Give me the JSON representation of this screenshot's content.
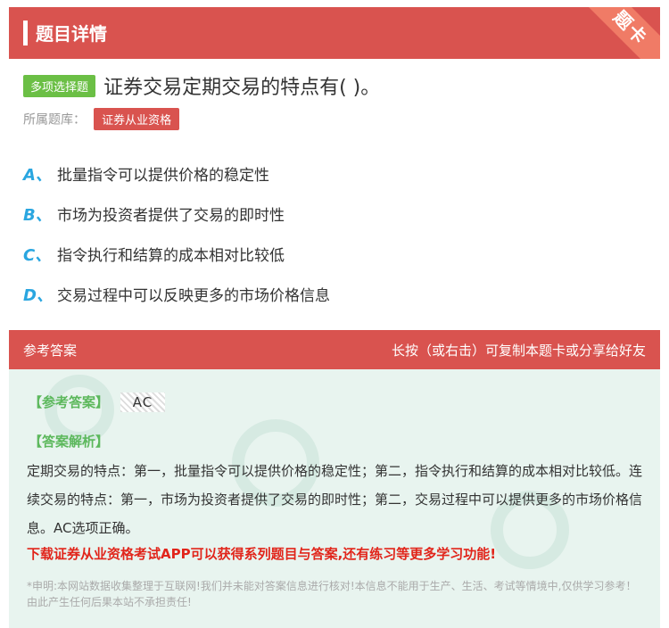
{
  "header": {
    "title": "题目详情",
    "ribbon": "题卡"
  },
  "question": {
    "type_tag": "多项选择题",
    "text": "证券交易定期交易的特点有( )。",
    "bank_label": "所属题库：",
    "bank_tag": "证券从业资格"
  },
  "options": [
    {
      "letter": "A、",
      "text": "批量指令可以提供价格的稳定性"
    },
    {
      "letter": "B、",
      "text": "市场为投资者提供了交易的即时性"
    },
    {
      "letter": "C、",
      "text": "指令执行和结算的成本相对比较低"
    },
    {
      "letter": "D、",
      "text": "交易过程中可以反映更多的市场价格信息"
    }
  ],
  "answer": {
    "head_left": "参考答案",
    "head_right": "长按（或右击）可复制本题卡或分享给好友",
    "ref_label": "【参考答案】",
    "ref_value": "AC",
    "analysis_label": "【答案解析】",
    "analysis_text": "定期交易的特点：第一，批量指令可以提供价格的稳定性；第二，指令执行和结算的成本相对比较低。连续交易的特点：第一，市场为投资者提供了交易的即时性；第二，交易过程中可以提供更多的市场价格信息。AC选项正确。",
    "promo": "下载证券从业资格考试APP可以获得系列题目与答案,还有练习等更多学习功能!",
    "disclaimer": "*申明:本网站数据收集整理于互联网!我们并未能对答案信息进行核对!本信息不能用于生产、生活、考试等情境中,仅供学习参考！由此产生任何后果本站不承担责任!"
  },
  "colors": {
    "header": "#d9534f",
    "type_tag": "#6bbf45",
    "option_letter": "#2aa6e0",
    "panel_bg": "#e8f4ef",
    "promo": "#e1251b"
  }
}
